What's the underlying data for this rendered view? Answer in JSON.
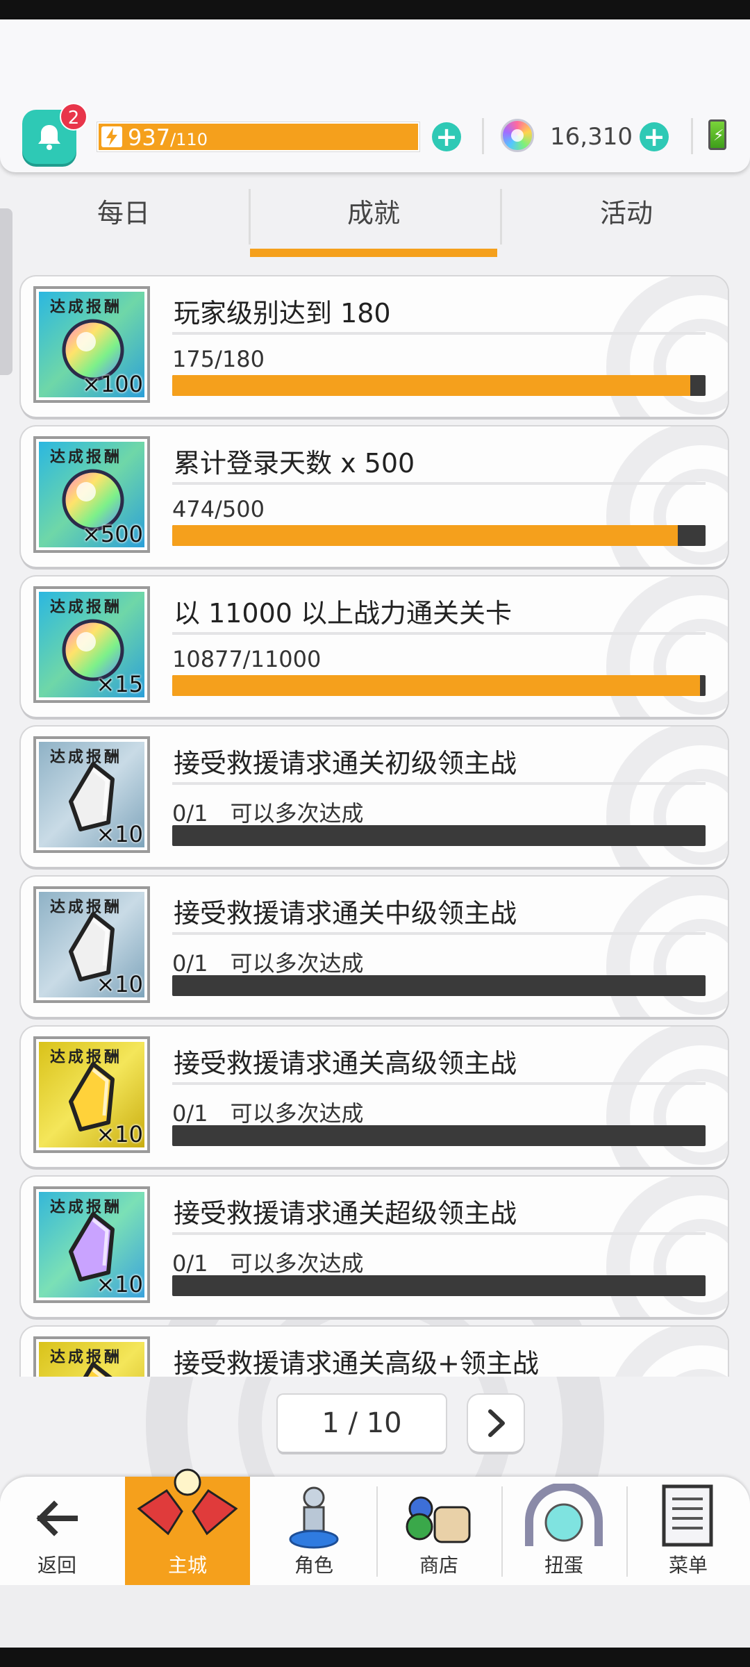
{
  "header": {
    "notification_count": "2",
    "energy_current": "937",
    "energy_max": "/110",
    "gem_count": "16,310"
  },
  "tabs": [
    {
      "label": "每日",
      "active": false
    },
    {
      "label": "成就",
      "active": true
    },
    {
      "label": "活动",
      "active": false
    }
  ],
  "achievements": [
    {
      "reward_label": "达成报酬",
      "reward_icon": "rainbow-orb-icon",
      "reward_multiplier": "×100",
      "title": "玩家级别达到 180",
      "progress_text": "175/180",
      "progress": 0.972
    },
    {
      "reward_label": "达成报酬",
      "reward_icon": "rainbow-orb-icon",
      "reward_multiplier": "×500",
      "title": "累计登录天数 x 500",
      "progress_text": "474/500",
      "progress": 0.948
    },
    {
      "reward_label": "达成报酬",
      "reward_icon": "rainbow-orb-icon",
      "reward_multiplier": "×15",
      "title": "以 11000 以上战力通关关卡",
      "progress_text": "10877/11000",
      "progress": 0.989
    },
    {
      "reward_label": "达成报酬",
      "reward_icon": "silver-crystal-icon",
      "reward_multiplier": "×10",
      "title": "接受救援请求通关初级领主战",
      "progress_text": "0/1　可以多次达成",
      "progress": 0
    },
    {
      "reward_label": "达成报酬",
      "reward_icon": "silver-crystal-icon",
      "reward_multiplier": "×10",
      "title": "接受救援请求通关中级领主战",
      "progress_text": "0/1　可以多次达成",
      "progress": 0
    },
    {
      "reward_label": "达成报酬",
      "reward_icon": "gold-crystal-icon",
      "reward_multiplier": "×10",
      "title": "接受救援请求通关高级领主战",
      "progress_text": "0/1　可以多次达成",
      "progress": 0
    },
    {
      "reward_label": "达成报酬",
      "reward_icon": "purple-crystal-icon",
      "reward_multiplier": "×10",
      "title": "接受救援请求通关超级领主战",
      "progress_text": "0/1　可以多次达成",
      "progress": 0
    },
    {
      "reward_label": "达成报酬",
      "reward_icon": "gold-crystal-icon",
      "reward_multiplier": "",
      "title": "接受救援请求通关高级+领主战",
      "progress_text": "",
      "progress": 0
    }
  ],
  "pager": {
    "text": "1 / 10"
  },
  "bottom_nav": [
    {
      "label": "返回",
      "icon": "arrow-left-icon"
    },
    {
      "label": "主城",
      "icon": "castle-icon"
    },
    {
      "label": "角色",
      "icon": "character-icon"
    },
    {
      "label": "商店",
      "icon": "shop-icon"
    },
    {
      "label": "扭蛋",
      "icon": "gacha-icon"
    },
    {
      "label": "菜单",
      "icon": "menu-list-icon"
    }
  ],
  "colors": {
    "accent": "#f5a01c",
    "teal": "#2ec9b5",
    "bar_empty": "#3a3a3a"
  }
}
